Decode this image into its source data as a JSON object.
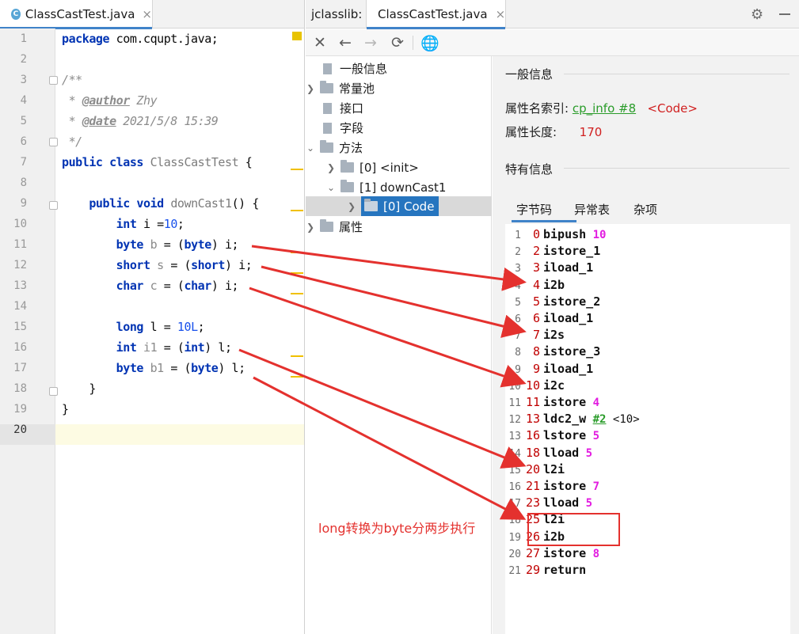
{
  "editor": {
    "tab": {
      "icon": "C",
      "label": "ClassCastTest.java",
      "close": "×"
    },
    "line_numbers": [
      "1",
      "2",
      "3",
      "4",
      "5",
      "6",
      "7",
      "8",
      "9",
      "10",
      "11",
      "12",
      "13",
      "14",
      "15",
      "16",
      "17",
      "18",
      "19",
      "20"
    ],
    "lines": {
      "l1": {
        "kw": "package",
        "rest": " com.cqupt.java;"
      },
      "l3": "/**",
      "l4": {
        "pre": " * ",
        "tag": "@author",
        "rest": " Zhy"
      },
      "l5": {
        "pre": " * ",
        "tag": "@date",
        "rest": " 2021/5/8 15:39"
      },
      "l6": " */",
      "l7": {
        "kw1": "public",
        "kw2": "class",
        "name": "ClassCastTest",
        "rest": " {"
      },
      "l9": {
        "kw1": "public",
        "kw2": "void",
        "name": "downCast1",
        "rest": "() {"
      },
      "l10": {
        "kw": "int",
        "var": " i =",
        "num": "10",
        "end": ";"
      },
      "l11": {
        "kw": "byte",
        "var": " b",
        "mid": " = (",
        "kw2": "byte",
        "end": ") i;"
      },
      "l12": {
        "kw": "short",
        "var": " s",
        "mid": " = (",
        "kw2": "short",
        "end": ") i;"
      },
      "l13": {
        "kw": "char",
        "var": " c",
        "mid": " = (",
        "kw2": "char",
        "end": ") i;"
      },
      "l15": {
        "kw": "long",
        "var": " l",
        "mid": " = ",
        "num": "10L",
        "end": ";"
      },
      "l16": {
        "kw": "int",
        "var": " i1",
        "mid": " = (",
        "kw2": "int",
        "end": ") l;"
      },
      "l17": {
        "kw": "byte",
        "var": " b1",
        "mid": " = (",
        "kw2": "byte",
        "end": ") l;"
      },
      "l18": "}",
      "l19": "}"
    }
  },
  "jclasslib": {
    "label": "jclasslib:",
    "tab": {
      "label": "ClassCastTest.java",
      "close": "×"
    },
    "toolbar": [
      "close-icon",
      "back-icon",
      "forward-icon",
      "refresh-icon",
      "browser-icon"
    ],
    "tree": [
      {
        "label": "一般信息"
      },
      {
        "label": "常量池"
      },
      {
        "label": "接口"
      },
      {
        "label": "字段"
      },
      {
        "label": "方法"
      },
      {
        "label": "[0] <init>"
      },
      {
        "label": "[1] downCast1"
      },
      {
        "label": "[0] Code"
      },
      {
        "label": "属性"
      }
    ],
    "detail": {
      "general_title": "一般信息",
      "attr_name_label": "属性名索引:",
      "attr_name_link": "cp_info #8",
      "attr_name_value": "<Code>",
      "attr_len_label": "属性长度:",
      "attr_len_value": "170",
      "specific_title": "特有信息",
      "tabs": [
        "字节码",
        "异常表",
        "杂项"
      ]
    },
    "bytecode": [
      {
        "n": "1",
        "off": "0",
        "ins": "bipush",
        "arg": "10"
      },
      {
        "n": "2",
        "off": "2",
        "ins": "istore_1"
      },
      {
        "n": "3",
        "off": "3",
        "ins": "iload_1"
      },
      {
        "n": "4",
        "off": "4",
        "ins": "i2b"
      },
      {
        "n": "5",
        "off": "5",
        "ins": "istore_2"
      },
      {
        "n": "6",
        "off": "6",
        "ins": "iload_1"
      },
      {
        "n": "7",
        "off": "7",
        "ins": "i2s"
      },
      {
        "n": "8",
        "off": "8",
        "ins": "istore_3"
      },
      {
        "n": "9",
        "off": "9",
        "ins": "iload_1"
      },
      {
        "n": "10",
        "off": "10",
        "ins": "i2c"
      },
      {
        "n": "11",
        "off": "11",
        "ins": "istore",
        "arg": "4"
      },
      {
        "n": "12",
        "off": "13",
        "ins": "ldc2_w",
        "ref": "#2",
        "cmt": "<10>"
      },
      {
        "n": "13",
        "off": "16",
        "ins": "lstore",
        "arg": "5"
      },
      {
        "n": "14",
        "off": "18",
        "ins": "lload",
        "arg": "5"
      },
      {
        "n": "15",
        "off": "20",
        "ins": "l2i"
      },
      {
        "n": "16",
        "off": "21",
        "ins": "istore",
        "arg": "7"
      },
      {
        "n": "17",
        "off": "23",
        "ins": "lload",
        "arg": "5"
      },
      {
        "n": "18",
        "off": "25",
        "ins": "l2i"
      },
      {
        "n": "19",
        "off": "26",
        "ins": "i2b"
      },
      {
        "n": "20",
        "off": "27",
        "ins": "istore",
        "arg": "8"
      },
      {
        "n": "21",
        "off": "29",
        "ins": "return"
      }
    ]
  },
  "annotation": {
    "text": "long转换为byte分两步执行",
    "color": "#e4312e"
  }
}
